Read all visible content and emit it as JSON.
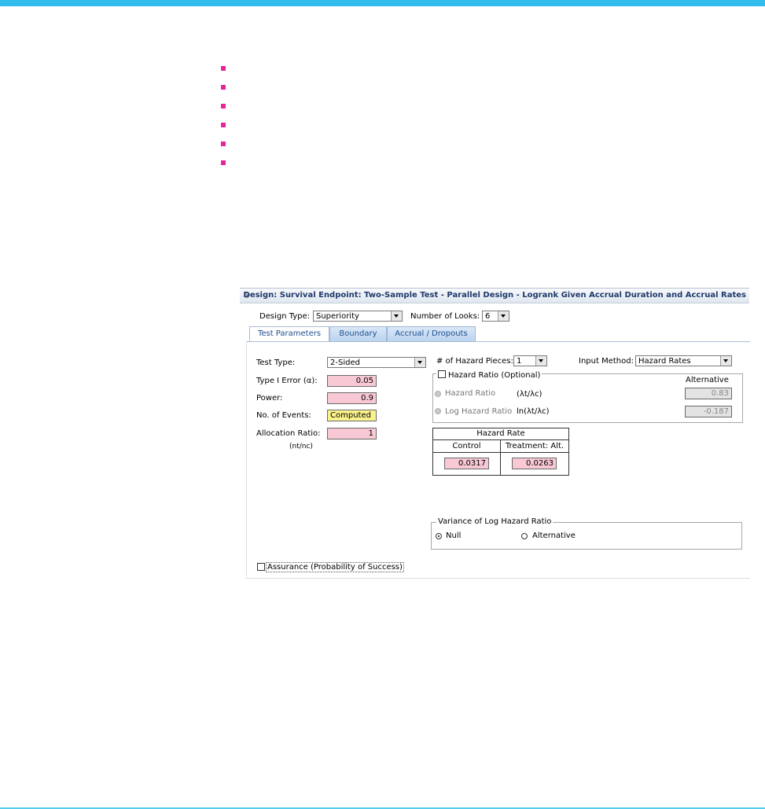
{
  "window": {
    "title": "Design: Survival Endpoint: Two-Sample Test - Parallel Design - Logrank Given Accrual Duration and Accrual Rates",
    "gear_icon": "gear-icon"
  },
  "header": {
    "design_type_label": "Design Type:",
    "design_type_value": "Superiority",
    "looks_label": "Number of Looks:",
    "looks_value": "6"
  },
  "tabs": [
    {
      "label": "Test Parameters",
      "active": true
    },
    {
      "label": "Boundary",
      "active": false
    },
    {
      "label": "Accrual / Dropouts",
      "active": false
    }
  ],
  "left": {
    "test_type_label": "Test Type:",
    "test_type_value": "2-Sided",
    "type1_label": "Type I Error (α):",
    "type1_value": "0.05",
    "power_label": "Power:",
    "power_value": "0.9",
    "events_label": "No. of Events:",
    "events_value": "Computed",
    "alloc_label": "Allocation Ratio:",
    "alloc_value": "1",
    "alloc_sub": "(nt/nc)"
  },
  "right": {
    "pieces_label": "# of Hazard Pieces:",
    "pieces_value": "1",
    "input_method_label": "Input Method:",
    "input_method_value": "Hazard Rates",
    "hazard_group_label": "Hazard Ratio (Optional)",
    "alternative_header": "Alternative",
    "hr_label": "Hazard Ratio",
    "hr_formula": "(λt/λc)",
    "hr_value": "0.83",
    "lhr_label": "Log Hazard Ratio",
    "lhr_formula": "ln(λt/λc)",
    "lhr_value": "-0.187"
  },
  "hazard_table": {
    "title": "Hazard Rate",
    "col_control": "Control",
    "col_treatment": "Treatment: Alt.",
    "control_value": "0.0317",
    "treatment_value": "0.0263"
  },
  "variance": {
    "label": "Variance of Log Hazard Ratio",
    "null_label": "Null",
    "alt_label": "Alternative",
    "selected": "Null"
  },
  "assurance_label": "Assurance (Probability of Success)"
}
